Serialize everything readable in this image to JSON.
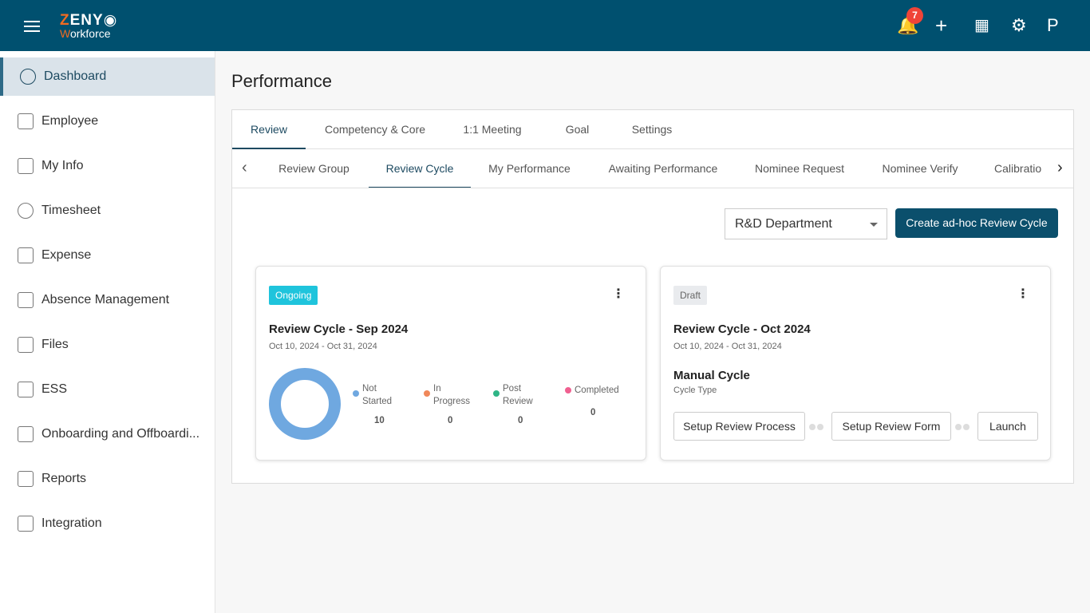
{
  "header": {
    "logo_top": "ZENY",
    "logo_bottom": "Workforce",
    "notification_count": "7",
    "avatar_letter": "P"
  },
  "sidebar": {
    "items": [
      {
        "label": "Dashboard",
        "icon": "pie-chart-icon",
        "active": true
      },
      {
        "label": "Employee",
        "icon": "employee-icon"
      },
      {
        "label": "My Info",
        "icon": "user-icon"
      },
      {
        "label": "Timesheet",
        "icon": "clock-icon"
      },
      {
        "label": "Expense",
        "icon": "money-icon"
      },
      {
        "label": "Absence Management",
        "icon": "exit-door-icon"
      },
      {
        "label": "Files",
        "icon": "file-icon"
      },
      {
        "label": "ESS",
        "icon": "monitor-user-icon"
      },
      {
        "label": "Onboarding and Offboardi...",
        "icon": "id-card-icon"
      },
      {
        "label": "Reports",
        "icon": "report-icon"
      },
      {
        "label": "Integration",
        "icon": "hierarchy-icon"
      }
    ]
  },
  "page": {
    "title": "Performance"
  },
  "tabs": [
    "Review",
    "Competency & Core",
    "1:1 Meeting",
    "Goal",
    "Settings"
  ],
  "subtabs": [
    "Review Group",
    "Review Cycle",
    "My Performance",
    "Awaiting Performance",
    "Nominee Request",
    "Nominee Verify",
    "Calibratio"
  ],
  "toolbar": {
    "department": "R&D Department",
    "create_label": "Create ad-hoc Review Cycle"
  },
  "cards": [
    {
      "status": "Ongoing",
      "status_color": "#1fc4dc",
      "title": "Review Cycle - Sep 2024",
      "dates": "Oct 10, 2024 - Oct 31, 2024",
      "legend": [
        {
          "label": "Not Started",
          "value": "10",
          "color": "#6fa8e0"
        },
        {
          "label": "In Progress",
          "value": "0",
          "color": "#f0885a"
        },
        {
          "label": "Post Review",
          "value": "0",
          "color": "#2fb586"
        },
        {
          "label": "Completed",
          "value": "0",
          "color": "#f06090"
        }
      ]
    },
    {
      "status": "Draft",
      "title": "Review Cycle - Oct 2024",
      "dates": "Oct 10, 2024 - Oct 31, 2024",
      "cycle_type": "Manual Cycle",
      "cycle_type_label": "Cycle Type",
      "buttons": [
        "Setup Review Process",
        "Setup Review Form",
        "Launch"
      ]
    }
  ]
}
